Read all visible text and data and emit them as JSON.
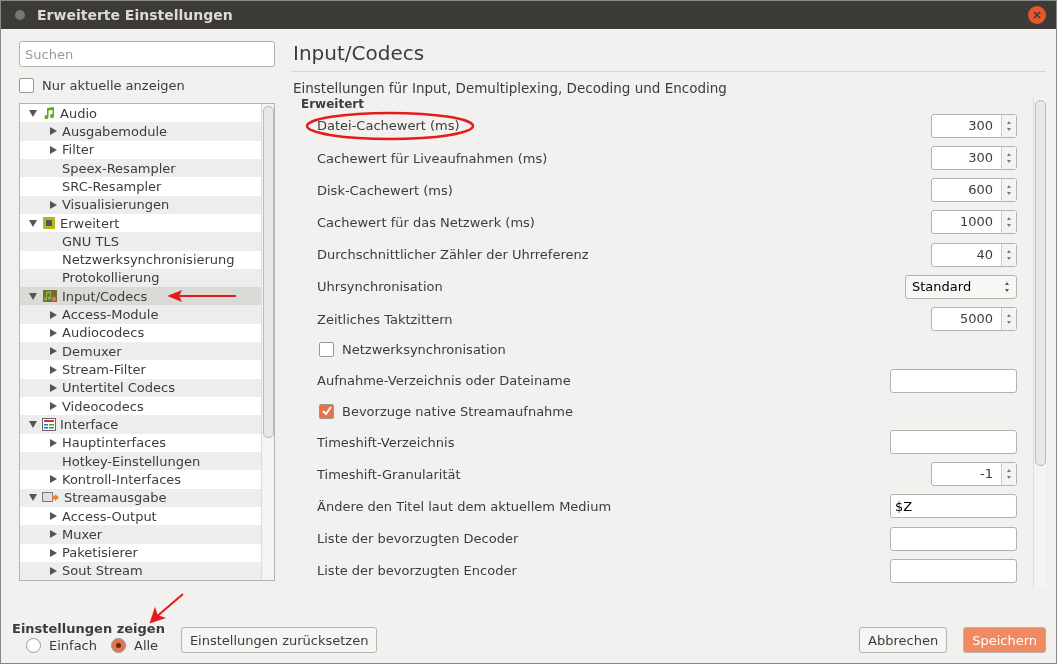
{
  "window": {
    "title": "Erweiterte Einstellungen"
  },
  "search": {
    "placeholder": "Suchen"
  },
  "only_current": {
    "label": "Nur aktuelle anzeigen",
    "checked": false
  },
  "tree": [
    {
      "label": "Audio",
      "expanded": true,
      "selected": false,
      "children": [
        {
          "label": "Ausgabemodule",
          "has_children": true
        },
        {
          "label": "Filter",
          "has_children": true
        },
        {
          "label": "Speex-Resampler",
          "has_children": false
        },
        {
          "label": "SRC-Resampler",
          "has_children": false
        },
        {
          "label": "Visualisierungen",
          "has_children": true
        }
      ]
    },
    {
      "label": "Erweitert",
      "expanded": true,
      "selected": false,
      "children": [
        {
          "label": "GNU TLS",
          "has_children": false
        },
        {
          "label": "Netzwerksynchronisierung",
          "has_children": false
        },
        {
          "label": "Protokollierung",
          "has_children": false
        }
      ]
    },
    {
      "label": "Input/Codecs",
      "expanded": true,
      "selected": true,
      "marked": true,
      "children": [
        {
          "label": "Access-Module",
          "has_children": true
        },
        {
          "label": "Audiocodecs",
          "has_children": true
        },
        {
          "label": "Demuxer",
          "has_children": true
        },
        {
          "label": "Stream-Filter",
          "has_children": true
        },
        {
          "label": "Untertitel Codecs",
          "has_children": true
        },
        {
          "label": "Videocodecs",
          "has_children": true
        }
      ]
    },
    {
      "label": "Interface",
      "expanded": true,
      "selected": false,
      "children": [
        {
          "label": "Hauptinterfaces",
          "has_children": true
        },
        {
          "label": "Hotkey-Einstellungen",
          "has_children": false
        },
        {
          "label": "Kontroll-Interfaces",
          "has_children": true
        }
      ]
    },
    {
      "label": "Streamausgabe",
      "expanded": true,
      "selected": false,
      "children": [
        {
          "label": "Access-Output",
          "has_children": true
        },
        {
          "label": "Muxer",
          "has_children": true
        },
        {
          "label": "Paketisierer",
          "has_children": true
        },
        {
          "label": "Sout Stream",
          "has_children": true
        }
      ]
    }
  ],
  "show_settings": {
    "label": "Einstellungen zeigen",
    "options": [
      {
        "label": "Einfach",
        "selected": false
      },
      {
        "label": "Alle",
        "selected": true,
        "marked": true
      }
    ]
  },
  "panel": {
    "title": "Input/Codecs",
    "subtitle": "Einstellungen für Input, Demultiplexing, Decoding und Encoding",
    "section": "Erweitert"
  },
  "settings": [
    {
      "kind": "spin",
      "label": "Datei-Cachewert (ms)",
      "value": "300",
      "circled": true
    },
    {
      "kind": "spin",
      "label": "Cachewert für Liveaufnahmen (ms)",
      "value": "300"
    },
    {
      "kind": "spin",
      "label": "Disk-Cachewert (ms)",
      "value": "600"
    },
    {
      "kind": "spin",
      "label": "Cachewert für das Netzwerk (ms)",
      "value": "1000"
    },
    {
      "kind": "spin",
      "label": "Durchschnittlicher Zähler der Uhrreferenz",
      "value": "40"
    },
    {
      "kind": "select",
      "label": "Uhrsynchronisation",
      "value": "Standard"
    },
    {
      "kind": "spin",
      "label": "Zeitliches Taktzittern",
      "value": "5000"
    },
    {
      "kind": "checkbox",
      "label": "Netzwerksynchronisation",
      "checked": false
    },
    {
      "kind": "text",
      "label": "Aufnahme-Verzeichnis oder Dateiname"
    },
    {
      "kind": "checkbox",
      "label": "Bevorzuge native Streamaufnahme",
      "checked": true
    },
    {
      "kind": "text",
      "label": "Timeshift-Verzeichnis"
    },
    {
      "kind": "spin",
      "label": "Timeshift-Granularität",
      "value": "-1"
    },
    {
      "kind": "text",
      "label": "Ändere den Titel laut dem aktuellem Medium",
      "value": "$Z"
    },
    {
      "kind": "text",
      "label": "Liste der bevorzugten Decoder"
    },
    {
      "kind": "text",
      "label": "Liste der bevorzugten Encoder"
    }
  ],
  "buttons": {
    "reset": "Einstellungen zurücksetzen",
    "cancel": "Abbrechen",
    "save": "Speichern"
  }
}
